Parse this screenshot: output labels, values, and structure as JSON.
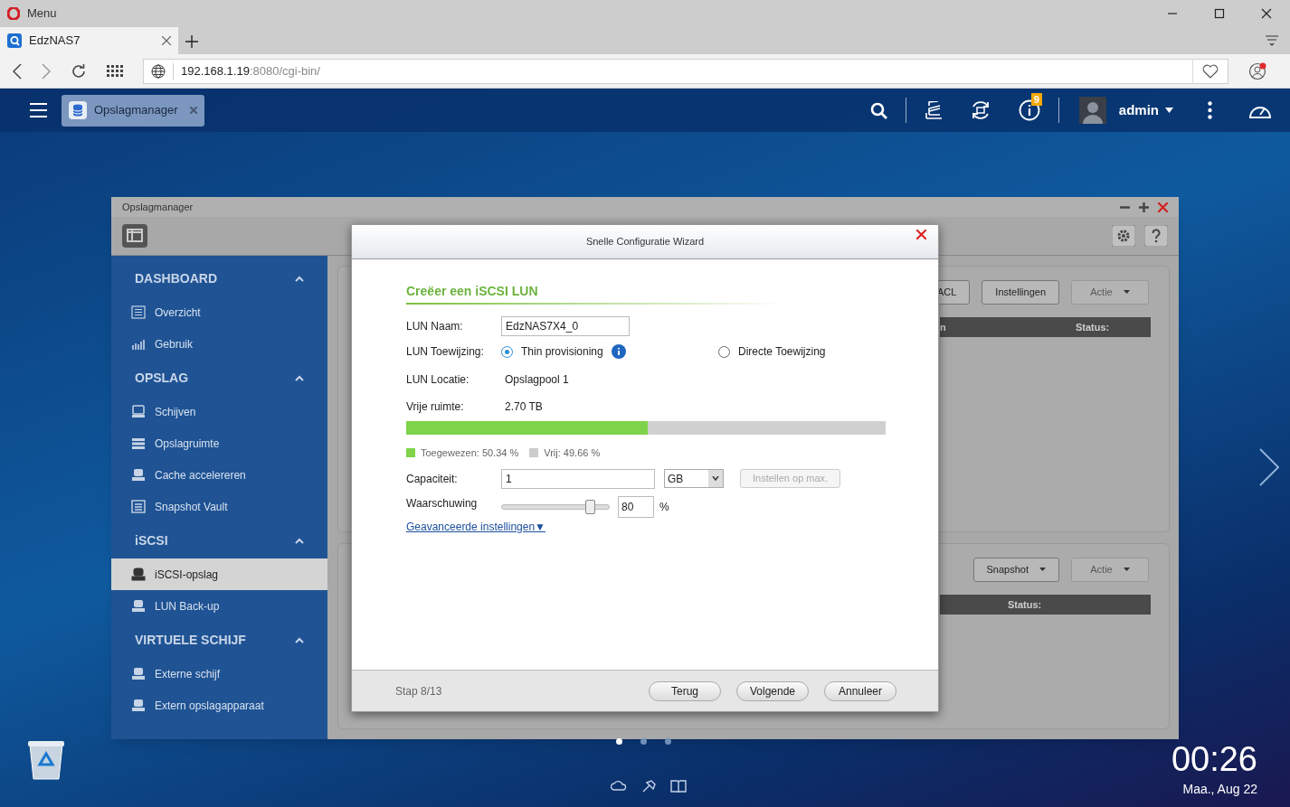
{
  "browser": {
    "menu_label": "Menu",
    "tabs": [
      {
        "title": "EdzNAS7",
        "selected": true
      }
    ],
    "address": {
      "host": "192.168.1.19",
      "rest": ":8080/cgi-bin/"
    }
  },
  "nas_bar": {
    "app_tabs": [
      {
        "label": "Opslagmanager",
        "selected": true
      }
    ],
    "notification_count": "9",
    "user": "admin"
  },
  "window": {
    "title": "Opslagmanager"
  },
  "sidebar": {
    "sections": [
      {
        "title": "DASHBOARD",
        "expanded": true,
        "items": [
          {
            "label": "Overzicht",
            "selected": false
          },
          {
            "label": "Gebruik",
            "selected": false
          }
        ]
      },
      {
        "title": "OPSLAG",
        "expanded": true,
        "items": [
          {
            "label": "Schijven",
            "selected": false
          },
          {
            "label": "Opslagruimte",
            "selected": false
          },
          {
            "label": "Cache accelereren",
            "selected": false
          },
          {
            "label": "Snapshot Vault",
            "selected": false
          }
        ]
      },
      {
        "title": "iSCSI",
        "expanded": true,
        "items": [
          {
            "label": "iSCSI-opslag",
            "selected": true
          },
          {
            "label": "LUN Back-up",
            "selected": false
          }
        ]
      },
      {
        "title": "VIRTUELE SCHIJF",
        "expanded": true,
        "items": [
          {
            "label": "Externe schijf",
            "selected": false
          },
          {
            "label": "Extern opslagapparaat",
            "selected": false
          }
        ]
      }
    ]
  },
  "panels": [
    {
      "buttons": [
        {
          "label": "ACL",
          "disabled": false,
          "dropdown": false
        },
        {
          "label": "Instellingen",
          "disabled": false,
          "dropdown": false
        },
        {
          "label": "Actie",
          "disabled": true,
          "dropdown": true
        }
      ],
      "columns": [
        "n",
        "Status:"
      ]
    },
    {
      "buttons": [
        {
          "label": "Snapshot",
          "disabled": false,
          "dropdown": true
        },
        {
          "label": "Actie",
          "disabled": true,
          "dropdown": true
        }
      ],
      "columns": [
        "Status:"
      ]
    }
  ],
  "dialog": {
    "title": "Snelle Configuratie Wizard",
    "heading": "Creëer een iSCSI LUN",
    "name": {
      "label": "LUN Naam:",
      "value": "EdzNAS7X4_0"
    },
    "allocation": {
      "label": "LUN Toewijzing:",
      "options": [
        {
          "label": "Thin provisioning",
          "selected": true,
          "info": true
        },
        {
          "label": "Directe Toewijzing",
          "selected": false,
          "info": false
        }
      ]
    },
    "location": {
      "label": "LUN Locatie:",
      "value": "Opslagpool 1"
    },
    "free_space": {
      "label": "Vrije ruimte:",
      "value": "2.70 TB",
      "level": 0.5034
    },
    "legend": [
      {
        "label": "Toegewezen: 50.34 %",
        "color": "#7ed34a"
      },
      {
        "label": "Vrij: 49.66 %",
        "color": "#cccccc"
      }
    ],
    "capacity": {
      "label": "Capaciteit:",
      "value": "1",
      "unit": "GB",
      "max_button": {
        "label": "Instellen op max.",
        "disabled": true
      }
    },
    "warning": {
      "label": "Waarschuwing",
      "level": 0.82,
      "value": "80",
      "unit": "%"
    },
    "advanced_link": "Geavanceerde instellingen▼",
    "step": "Stap 8/13",
    "buttons": [
      "Terug",
      "Volgende",
      "Annuleer"
    ]
  },
  "desktop": {
    "clock": "00:26",
    "date": "Maa., Aug 22"
  }
}
